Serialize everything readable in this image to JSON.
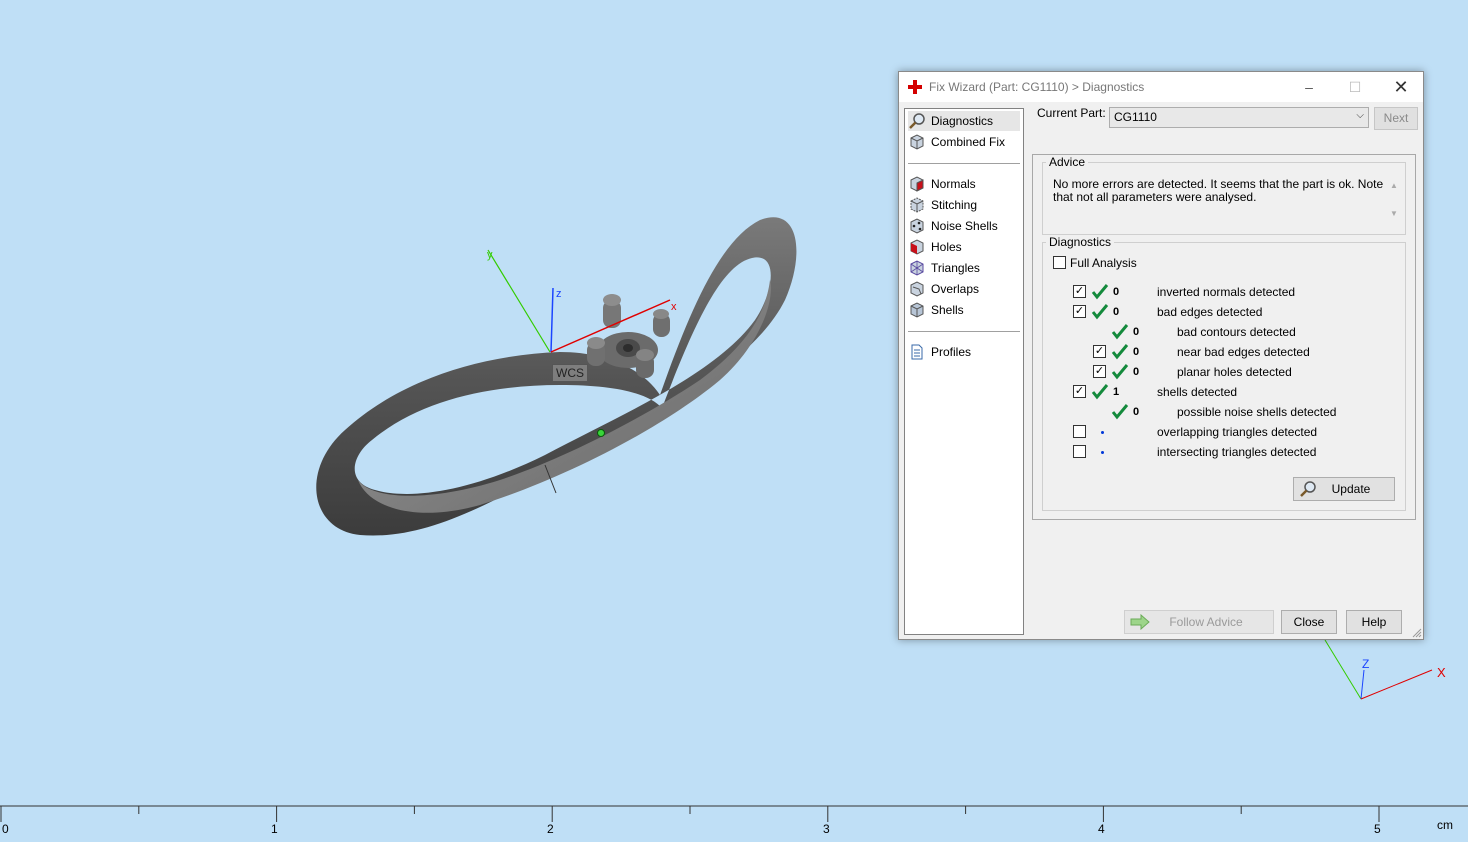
{
  "colors": {
    "background": "#bfdff6",
    "axis_x": "#e00000",
    "axis_y": "#33cc00",
    "axis_z": "#1a44ff",
    "check_green": "#148a3c"
  },
  "viewport": {
    "wcs_label": "WCS",
    "world_axes": {
      "x": "x",
      "y": "y",
      "z": "z"
    },
    "corner_axes": {
      "x": "X",
      "z": "Z"
    }
  },
  "ruler": {
    "ticks": [
      "0",
      "1",
      "2",
      "3",
      "4",
      "5"
    ],
    "unit": "cm"
  },
  "dialog": {
    "title": "Fix Wizard (Part: CG1110) > Diagnostics",
    "window_buttons": {
      "minimize": "–",
      "maximize": "☐",
      "close": "✕"
    },
    "nav": {
      "top": [
        {
          "label": "Diagnostics",
          "icon": "magnifier-icon"
        },
        {
          "label": "Combined Fix",
          "icon": "cube-icon"
        }
      ],
      "fixes": [
        {
          "label": "Normals",
          "icon": "normals-cube-icon"
        },
        {
          "label": "Stitching",
          "icon": "stitching-cube-icon"
        },
        {
          "label": "Noise Shells",
          "icon": "noise-shells-icon"
        },
        {
          "label": "Holes",
          "icon": "holes-cube-icon"
        },
        {
          "label": "Triangles",
          "icon": "triangles-cube-icon"
        },
        {
          "label": "Overlaps",
          "icon": "overlaps-cube-icon"
        },
        {
          "label": "Shells",
          "icon": "shells-cube-icon"
        }
      ],
      "bottom": [
        {
          "label": "Profiles",
          "icon": "document-icon"
        }
      ]
    },
    "current_part_label": "Current Part:",
    "current_part_value": "CG1110",
    "next_button": "Next",
    "advice": {
      "legend": "Advice",
      "text": "No more errors are detected. It seems that the part is ok. Note that not all parameters were analysed."
    },
    "diagnostics": {
      "legend": "Diagnostics",
      "full_analysis_label": "Full Analysis",
      "full_analysis_checked": false,
      "rows": [
        {
          "checkbox": true,
          "checked": true,
          "status": "ok",
          "count": "0",
          "label": "inverted normals detected",
          "indent": 0
        },
        {
          "checkbox": true,
          "checked": true,
          "status": "ok",
          "count": "0",
          "label": "bad edges detected",
          "indent": 0
        },
        {
          "checkbox": false,
          "checked": false,
          "status": "ok",
          "count": "0",
          "label": "bad contours detected",
          "indent": 1
        },
        {
          "checkbox": true,
          "checked": true,
          "status": "ok",
          "count": "0",
          "label": "near bad edges detected",
          "indent": 1
        },
        {
          "checkbox": true,
          "checked": true,
          "status": "ok",
          "count": "0",
          "label": "planar holes detected",
          "indent": 1
        },
        {
          "checkbox": true,
          "checked": true,
          "status": "ok",
          "count": "1",
          "label": "shells detected",
          "indent": 0
        },
        {
          "checkbox": false,
          "checked": false,
          "status": "ok",
          "count": "0",
          "label": "possible noise shells detected",
          "indent": 1
        },
        {
          "checkbox": true,
          "checked": false,
          "status": "none",
          "count": "",
          "label": "overlapping triangles detected",
          "indent": 0
        },
        {
          "checkbox": true,
          "checked": false,
          "status": "none",
          "count": "",
          "label": "intersecting triangles detected",
          "indent": 0
        }
      ],
      "update_button": "Update"
    },
    "follow_advice_button": "Follow Advice",
    "close_button": "Close",
    "help_button": "Help"
  }
}
